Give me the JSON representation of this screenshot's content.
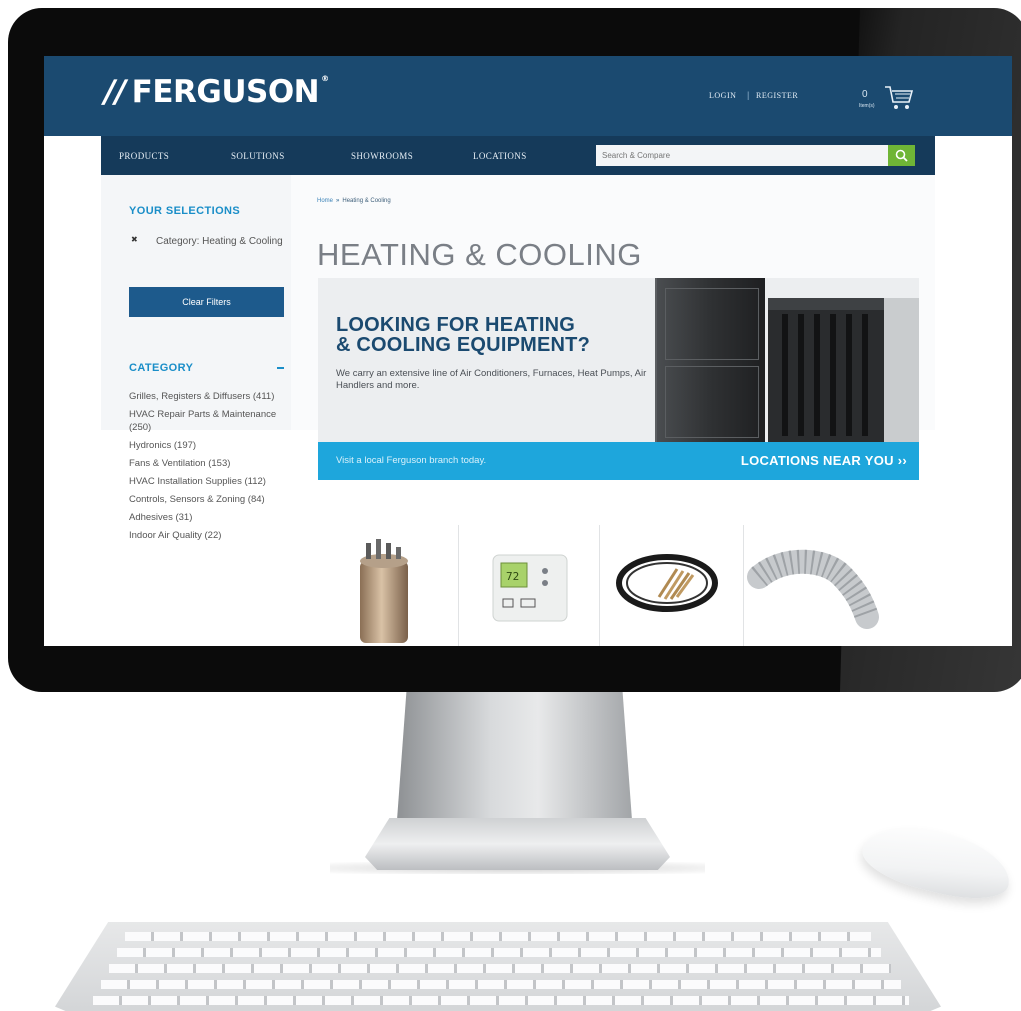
{
  "brand": {
    "logo_text": "FERGUSON",
    "logo_mark": "✦✦"
  },
  "header": {
    "login": "LOGIN",
    "register": "REGISTER",
    "cart_count": "0",
    "cart_label": "Item(s)"
  },
  "nav": {
    "items": [
      "PRODUCTS",
      "SOLUTIONS",
      "SHOWROOMS",
      "LOCATIONS"
    ],
    "search_placeholder": "Search & Compare"
  },
  "sidebar": {
    "selections_title": "YOUR SELECTIONS",
    "selection": "Category: Heating & Cooling",
    "clear_filters": "Clear Filters",
    "category_title": "CATEGORY",
    "categories": [
      "Grilles, Registers & Diffusers (411)",
      "HVAC Repair Parts & Maintenance (250)",
      "Hydronics (197)",
      "Fans & Ventilation (153)",
      "HVAC Installation Supplies (112)",
      "Controls, Sensors & Zoning (84)",
      "Adhesives (31)",
      "Indoor Air Quality (22)"
    ]
  },
  "breadcrumb": {
    "home": "Home",
    "current": "Heating & Cooling"
  },
  "page_title": "HEATING & COOLING",
  "hero": {
    "title_line1": "LOOKING FOR HEATING",
    "title_line2": "& COOLING EQUIPMENT?",
    "body": "We carry an extensive line of Air Conditioners, Furnaces, Heat Pumps, Air Handlers and more.",
    "strip_left": "Visit a local Ferguson branch today.",
    "strip_right": "LOCATIONS NEAR YOU ››"
  },
  "colors": {
    "header_bg": "#1b4a70",
    "nav_bg": "#153a5a",
    "accent_blue": "#1a8ec8",
    "strip_blue": "#1ea6dc",
    "search_green": "#6fb536"
  },
  "products": [
    {
      "icon": "capacitor-icon"
    },
    {
      "icon": "thermostat-icon"
    },
    {
      "icon": "line-set-icon"
    },
    {
      "icon": "flex-duct-icon"
    }
  ]
}
